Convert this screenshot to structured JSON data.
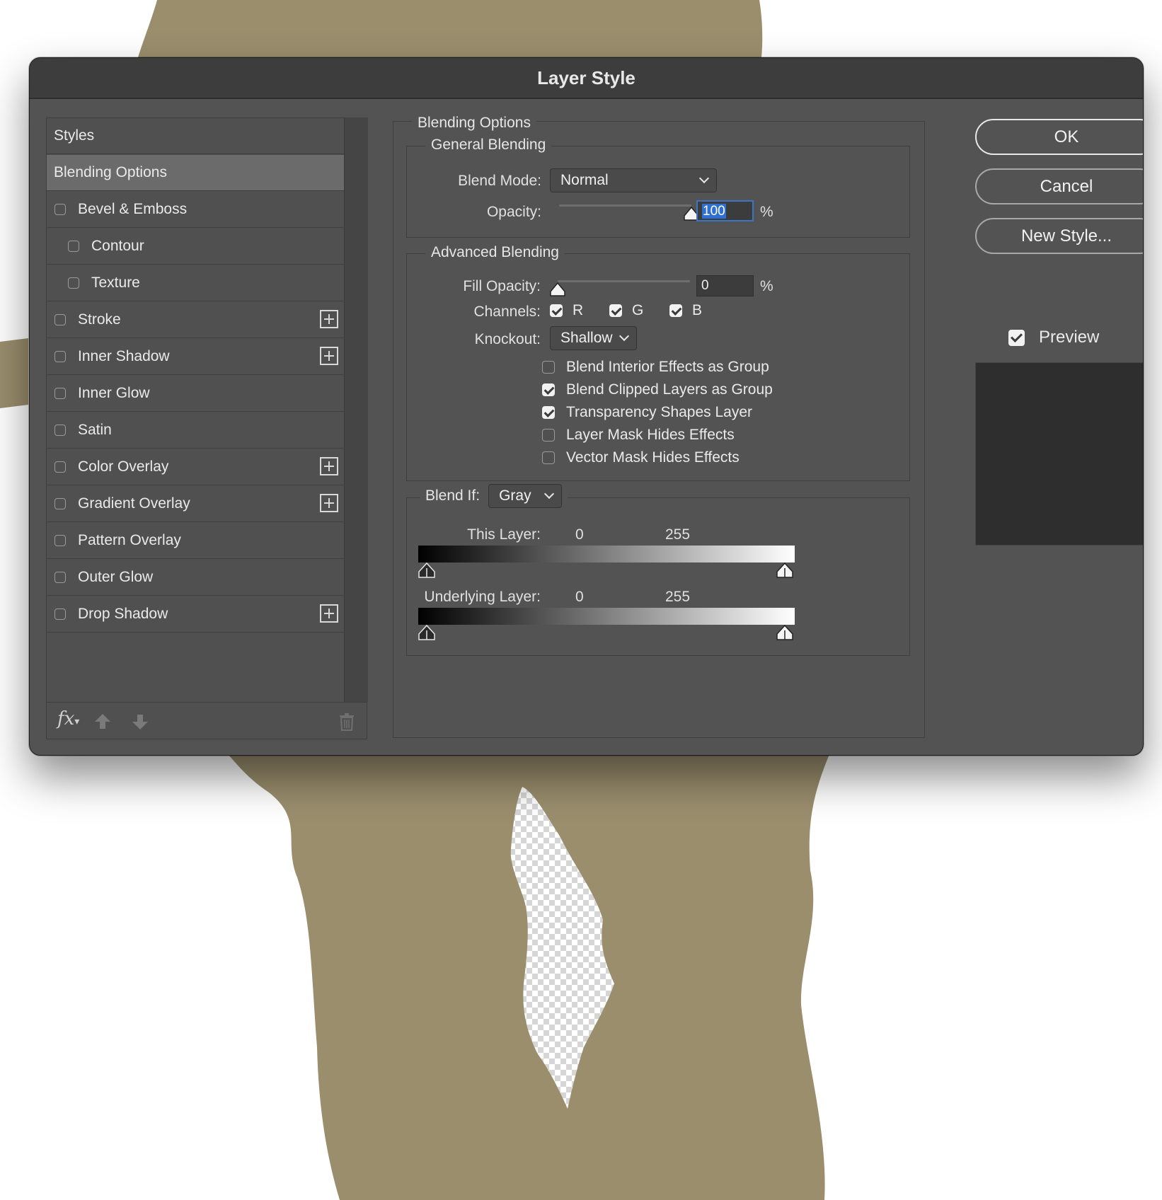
{
  "dialog": {
    "title": "Layer Style"
  },
  "styles_panel": {
    "header": "Styles",
    "items": [
      {
        "label": "Blending Options",
        "selected": true,
        "checkbox": false,
        "checked": false,
        "indent": false,
        "plus": false
      },
      {
        "label": "Bevel & Emboss",
        "selected": false,
        "checkbox": true,
        "checked": false,
        "indent": false,
        "plus": false
      },
      {
        "label": "Contour",
        "selected": false,
        "checkbox": true,
        "checked": false,
        "indent": true,
        "plus": false
      },
      {
        "label": "Texture",
        "selected": false,
        "checkbox": true,
        "checked": false,
        "indent": true,
        "plus": false
      },
      {
        "label": "Stroke",
        "selected": false,
        "checkbox": true,
        "checked": false,
        "indent": false,
        "plus": true
      },
      {
        "label": "Inner Shadow",
        "selected": false,
        "checkbox": true,
        "checked": false,
        "indent": false,
        "plus": true
      },
      {
        "label": "Inner Glow",
        "selected": false,
        "checkbox": true,
        "checked": false,
        "indent": false,
        "plus": false
      },
      {
        "label": "Satin",
        "selected": false,
        "checkbox": true,
        "checked": false,
        "indent": false,
        "plus": false
      },
      {
        "label": "Color Overlay",
        "selected": false,
        "checkbox": true,
        "checked": false,
        "indent": false,
        "plus": true
      },
      {
        "label": "Gradient Overlay",
        "selected": false,
        "checkbox": true,
        "checked": false,
        "indent": false,
        "plus": true
      },
      {
        "label": "Pattern Overlay",
        "selected": false,
        "checkbox": true,
        "checked": false,
        "indent": false,
        "plus": false
      },
      {
        "label": "Outer Glow",
        "selected": false,
        "checkbox": true,
        "checked": false,
        "indent": false,
        "plus": false
      },
      {
        "label": "Drop Shadow",
        "selected": false,
        "checkbox": true,
        "checked": false,
        "indent": false,
        "plus": true
      }
    ],
    "footer": {
      "fx_label": "fx",
      "icons": [
        "fx-icon",
        "move-up-icon",
        "move-down-icon",
        "trash-icon"
      ]
    }
  },
  "blending_options": {
    "section_title": "Blending Options",
    "general": {
      "title": "General Blending",
      "blend_mode_label": "Blend Mode:",
      "blend_mode_value": "Normal",
      "opacity_label": "Opacity:",
      "opacity_value": "100",
      "opacity_unit": "%",
      "opacity_level": 1.0
    },
    "advanced": {
      "title": "Advanced Blending",
      "fill_opacity_label": "Fill Opacity:",
      "fill_opacity_value": "0",
      "fill_opacity_unit": "%",
      "fill_opacity_level": 0.0,
      "channels_label": "Channels:",
      "channels": [
        {
          "label": "R",
          "checked": true
        },
        {
          "label": "G",
          "checked": true
        },
        {
          "label": "B",
          "checked": true
        }
      ],
      "knockout_label": "Knockout:",
      "knockout_value": "Shallow",
      "options": [
        {
          "label": "Blend Interior Effects as Group",
          "checked": false
        },
        {
          "label": "Blend Clipped Layers as Group",
          "checked": true
        },
        {
          "label": "Transparency Shapes Layer",
          "checked": true
        },
        {
          "label": "Layer Mask Hides Effects",
          "checked": false
        },
        {
          "label": "Vector Mask Hides Effects",
          "checked": false
        }
      ]
    },
    "blend_if": {
      "label": "Blend If:",
      "value": "Gray",
      "this_layer": {
        "label": "This Layer:",
        "min": "0",
        "max": "255"
      },
      "underlying_layer": {
        "label": "Underlying Layer:",
        "min": "0",
        "max": "255"
      }
    }
  },
  "buttons": {
    "ok": "OK",
    "cancel": "Cancel",
    "new_style": "New Style...",
    "preview_label": "Preview",
    "preview_checked": true
  },
  "colors": {
    "backdrop_shape": "#9a8e6d",
    "dialog_bg": "#535353",
    "titlebar_bg": "#3d3d3d",
    "selection_blue": "#2f6fd0",
    "selected_row": "#6b6b6b"
  }
}
